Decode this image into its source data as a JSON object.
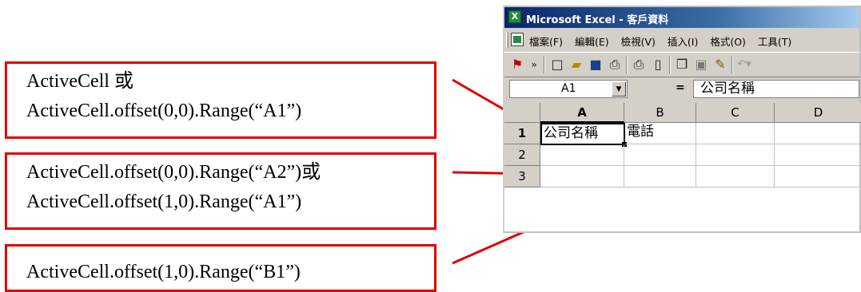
{
  "excel": {
    "title": "Microsoft Excel - 客戶資料",
    "menu": [
      "檔案(F)",
      "編輯(E)",
      "檢視(V)",
      "插入(I)",
      "格式(O)",
      "工具(T)"
    ],
    "name_box": "A1",
    "equals": "=",
    "formula_value": "公司名稱",
    "columns": [
      "A",
      "B",
      "C",
      "D"
    ],
    "rows": [
      "1",
      "2",
      "3"
    ],
    "cells": {
      "A1": "公司名稱",
      "B1": "電話"
    }
  },
  "callouts": [
    {
      "lines": [
        "ActiveCell 或",
        "ActiveCell.offset(0,0).Range(“A1”)"
      ]
    },
    {
      "lines": [
        "ActiveCell.offset(0,0).Range(“A2”)或",
        "ActiveCell.offset(1,0).Range(“A1”)"
      ]
    },
    {
      "lines": [
        "ActiveCell.offset(1,0).Range(“B1”)"
      ]
    }
  ],
  "colors": {
    "annotation": "#e00000",
    "title_bar": "#0a246a",
    "excel_icon": "#1f8f3a"
  },
  "icons": [
    "excel-app-icon",
    "pdf-icon",
    "new-icon",
    "open-icon",
    "save-icon",
    "print-icon",
    "print-preview-icon",
    "copy-icon",
    "paste-icon",
    "format-painter-icon",
    "undo-icon"
  ]
}
